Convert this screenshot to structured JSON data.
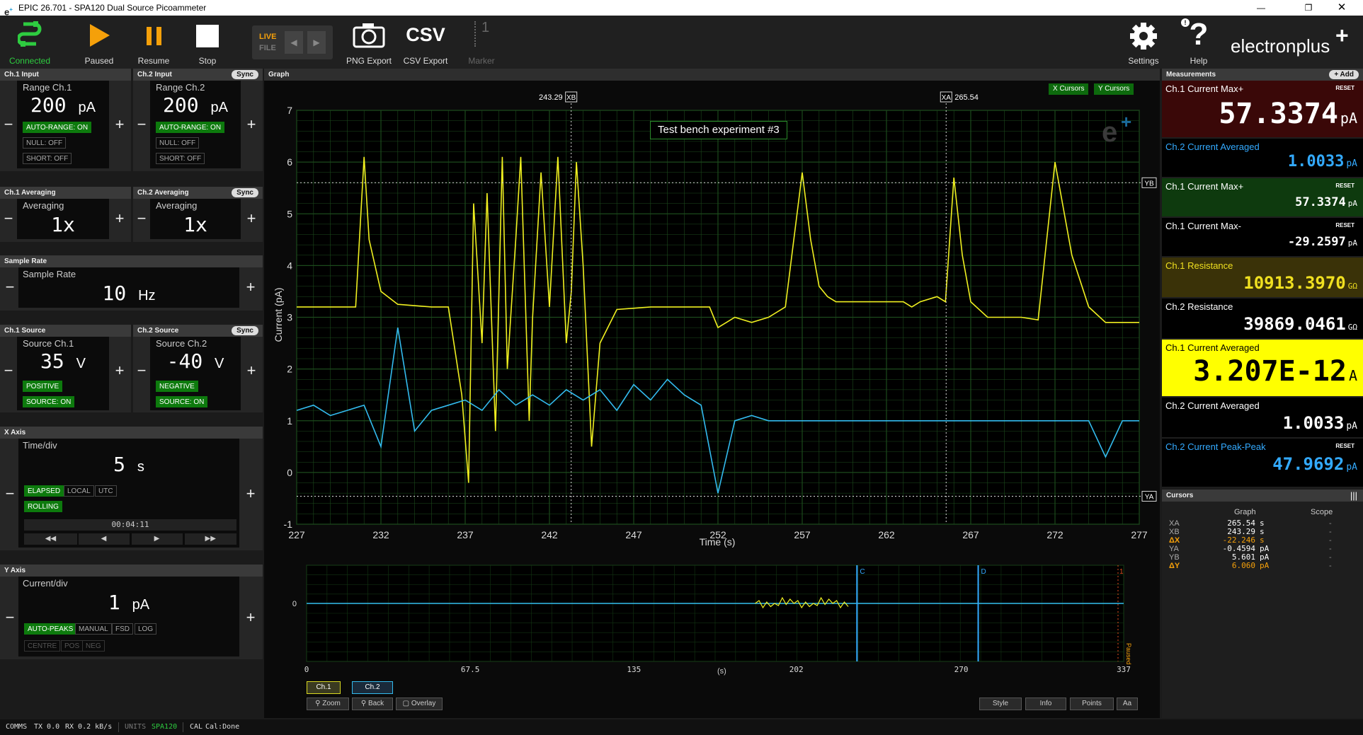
{
  "window": {
    "title": "EPIC 26.701 - SPA120 Dual Source Picoammeter"
  },
  "toolbar": {
    "connected": "Connected",
    "paused": "Paused",
    "resume": "Resume",
    "stop": "Stop",
    "live": "LIVE",
    "file": "FILE",
    "png_export": "PNG Export",
    "csv_export": "CSV Export",
    "csv_icon": "CSV",
    "marker_num": "1",
    "marker": "Marker",
    "settings": "Settings",
    "help": "Help",
    "brand": "electronplus",
    "brand_plus": "+"
  },
  "ch1_input": {
    "header": "Ch.1 Input",
    "label": "Range Ch.1",
    "value": "200",
    "unit": "pA",
    "autorange": "AUTO-RANGE: ON",
    "null": "NULL: OFF",
    "short": "SHORT: OFF"
  },
  "ch2_input": {
    "header": "Ch.2 Input",
    "sync": "Sync",
    "label": "Range Ch.2",
    "value": "200",
    "unit": "pA",
    "autorange": "AUTO-RANGE: ON",
    "null": "NULL: OFF",
    "short": "SHORT: OFF"
  },
  "ch1_avg": {
    "header": "Ch.1 Averaging",
    "label": "Averaging",
    "value": "1x"
  },
  "ch2_avg": {
    "header": "Ch.2 Averaging",
    "sync": "Sync",
    "label": "Averaging",
    "value": "1x"
  },
  "sample_rate": {
    "header": "Sample Rate",
    "label": "Sample Rate",
    "value": "10",
    "unit": "Hz"
  },
  "ch1_source": {
    "header": "Ch.1 Source",
    "label": "Source Ch.1",
    "value": "35",
    "unit": "V",
    "polarity": "POSITIVE",
    "source": "SOURCE: ON"
  },
  "ch2_source": {
    "header": "Ch.2 Source",
    "sync": "Sync",
    "label": "Source Ch.2",
    "value": "-40",
    "unit": "V",
    "polarity": "NEGATIVE",
    "source": "SOURCE: ON"
  },
  "x_axis": {
    "header": "X Axis",
    "label": "Time/div",
    "value": "5",
    "unit": "s",
    "elapsed": "ELAPSED",
    "local": "LOCAL",
    "utc": "UTC",
    "rolling": "ROLLING",
    "time": "00:04:11"
  },
  "y_axis": {
    "header": "Y Axis",
    "label": "Current/div",
    "value": "1",
    "unit": "pA",
    "autopeaks": "AUTO-PEAKS",
    "manual": "MANUAL",
    "fsd": "FSD",
    "log": "LOG",
    "centre": "CENTRE",
    "pos": "POS",
    "neg": "NEG"
  },
  "graph": {
    "header": "Graph",
    "x_cursors": "X Cursors",
    "y_cursors": "Y Cursors",
    "annotation": "Test bench experiment #3",
    "ylabel": "Current (pA)",
    "xlabel": "Time (s)",
    "xb_value": "243.29",
    "xb_tag": "XB",
    "xa_value": "265.54",
    "xa_tag": "XA",
    "yb_tag": "YB",
    "ya_tag": "YA",
    "watermark": "e",
    "xticks": [
      "227",
      "232",
      "237",
      "242",
      "247",
      "252",
      "257",
      "262",
      "267",
      "272",
      "277"
    ],
    "yticks": [
      "7",
      "6",
      "5",
      "4",
      "3",
      "2",
      "1",
      "0",
      "-1"
    ],
    "colors": {
      "ch1": "#f0f020",
      "ch2": "#33bbee",
      "grid": "#1c4a1c",
      "plot_border": "#2a8a2a"
    }
  },
  "chart_data": {
    "type": "line",
    "xlabel": "Time (s)",
    "ylabel": "Current (pA)",
    "xlim": [
      227,
      277
    ],
    "ylim": [
      -1,
      7
    ],
    "x_cursors": {
      "XA": 265.54,
      "XB": 243.29
    },
    "y_cursors": {
      "YA": -0.4594,
      "YB": 5.601
    },
    "series": [
      {
        "name": "Ch.1",
        "x": [
          227,
          230.5,
          231,
          231.3,
          232,
          233,
          235,
          236,
          236.8,
          237.2,
          237.5,
          238,
          238.3,
          238.8,
          239.2,
          239.5,
          240,
          240.3,
          240.8,
          241,
          241.5,
          242,
          242.5,
          243,
          243.3,
          243.6,
          244,
          244.5,
          245,
          246,
          248,
          251.5,
          252,
          252.5,
          253,
          254,
          255,
          256,
          257,
          257.5,
          258,
          258.5,
          259,
          260,
          262,
          263,
          263.5,
          264,
          265,
          265.5,
          266,
          266.5,
          267,
          268,
          269,
          270,
          271,
          272,
          273,
          274,
          275,
          276,
          277
        ],
        "y": [
          3.2,
          3.2,
          6.1,
          4.5,
          3.5,
          3.25,
          3.2,
          3.2,
          1.5,
          -0.2,
          5.2,
          2.5,
          5.4,
          0.8,
          6.1,
          2.0,
          4.5,
          6.1,
          1.0,
          3.0,
          5.8,
          3.2,
          6.1,
          2.5,
          3.5,
          6.0,
          4.0,
          0.5,
          2.5,
          3.15,
          3.2,
          3.2,
          2.8,
          2.9,
          3.0,
          2.9,
          3.0,
          3.2,
          5.8,
          4.5,
          3.6,
          3.4,
          3.3,
          3.3,
          3.3,
          3.3,
          3.2,
          3.3,
          3.4,
          3.3,
          5.7,
          4.2,
          3.3,
          3.0,
          3.0,
          3.0,
          2.95,
          6.0,
          4.2,
          3.2,
          2.9,
          2.9,
          2.9
        ]
      },
      {
        "name": "Ch.2",
        "x": [
          227,
          228,
          229,
          230,
          231,
          232,
          233,
          234,
          235,
          236,
          237,
          238,
          239,
          240,
          241,
          242,
          243,
          244,
          245,
          246,
          247,
          248,
          249,
          250,
          251,
          252,
          253,
          254,
          255,
          256,
          257,
          258,
          259,
          260,
          261,
          262,
          263,
          264,
          265,
          266,
          267,
          268,
          269,
          270,
          271,
          272,
          273,
          274,
          275,
          276,
          277
        ],
        "y": [
          1.2,
          1.3,
          1.1,
          1.2,
          1.3,
          0.5,
          2.8,
          0.8,
          1.2,
          1.3,
          1.4,
          1.2,
          1.6,
          1.3,
          1.5,
          1.3,
          1.6,
          1.4,
          1.6,
          1.2,
          1.7,
          1.4,
          1.8,
          1.5,
          1.3,
          -0.4,
          1.0,
          1.1,
          1.0,
          1.0,
          1.0,
          1.0,
          1.0,
          1.0,
          1.0,
          1.0,
          1.0,
          1.0,
          1.0,
          1.0,
          1.0,
          1.0,
          1.0,
          1.0,
          1.0,
          1.0,
          1.0,
          1.0,
          0.3,
          1.0,
          1.0
        ]
      }
    ]
  },
  "overview": {
    "ylabel": "0",
    "xticks": [
      "0",
      "67.5",
      "135",
      "202",
      "270",
      "337"
    ],
    "xlabel": "(s)",
    "marker_c": "C",
    "marker_d": "D",
    "marker_1": "1",
    "paused": "Paused"
  },
  "graph_footer": {
    "ch1": "Ch.1",
    "ch2": "Ch.2",
    "zoom": "Zoom",
    "back": "Back",
    "overlay": "Overlay",
    "style": "Style",
    "info": "Info",
    "points": "Points",
    "aa": "Aa"
  },
  "measurements": {
    "header": "Measurements",
    "add": "+ Add",
    "reset": "RESET",
    "items": [
      {
        "title": "Ch.1 Current Max+",
        "value": "57.3374",
        "unit": "pA"
      },
      {
        "title": "Ch.2 Current Averaged",
        "value": "1.0033",
        "unit": "pA"
      },
      {
        "title": "Ch.1 Current Max+",
        "value": "57.3374",
        "unit": "pA"
      },
      {
        "title": "Ch.1 Current Max-",
        "value": "-29.2597",
        "unit": "pA"
      },
      {
        "title": "Ch.1 Resistance",
        "value": "10913.3970",
        "unit": "GΩ"
      },
      {
        "title": "Ch.2 Resistance",
        "value": "39869.0461",
        "unit": "GΩ"
      },
      {
        "title": "Ch.1 Current Averaged",
        "value": "3.207E-12",
        "unit": "A"
      },
      {
        "title": "Ch.2 Current Averaged",
        "value": "1.0033",
        "unit": "pA"
      },
      {
        "title": "Ch.2 Current Peak-Peak",
        "value": "47.9692",
        "unit": "pA"
      }
    ]
  },
  "cursors": {
    "header": "Cursors",
    "col_graph": "Graph",
    "col_scope": "Scope",
    "rows": [
      {
        "name": "XA",
        "value": "265.54",
        "unit": "s",
        "scope": "-"
      },
      {
        "name": "XB",
        "value": "243.29",
        "unit": "s",
        "scope": "-"
      },
      {
        "name": "ΔX",
        "value": "-22.246",
        "unit": "s",
        "scope": "-"
      },
      {
        "name": "YA",
        "value": "-0.4594",
        "unit": "pA",
        "scope": "-"
      },
      {
        "name": "YB",
        "value": "5.601",
        "unit": "pA",
        "scope": "-"
      },
      {
        "name": "ΔY",
        "value": "6.060",
        "unit": "pA",
        "scope": "-"
      }
    ]
  },
  "status": {
    "comms": "COMMS",
    "tx": "TX 0.0",
    "rx": "RX 0.2 kB/s",
    "units_label": "UNITS",
    "units": "SPA120",
    "cal_label": "CAL",
    "cal": "Cal:Done"
  }
}
